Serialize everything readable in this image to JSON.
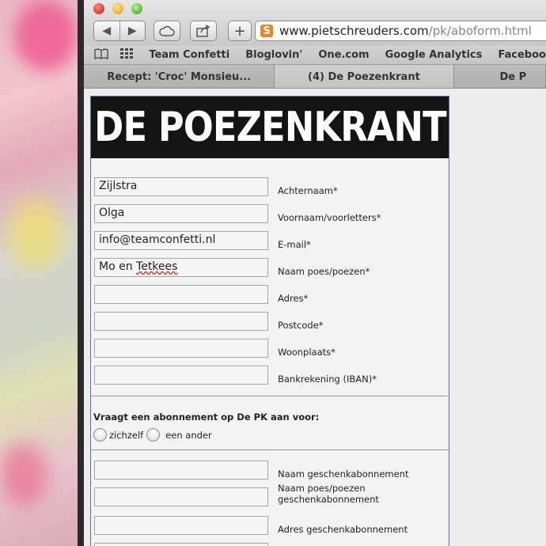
{
  "browser": {
    "url_host": "www.pietschreuders.com",
    "url_path": "/pk/aboform.html",
    "favicon_letter": "S",
    "buttons": {
      "back": "◀",
      "forward": "▶",
      "add": "+"
    },
    "bookmarks": [
      "Team Confetti",
      "Bloglovin'",
      "One.com",
      "Google Analytics",
      "Faceboo"
    ],
    "tabs": [
      "Recept: 'Croc' Monsieu...",
      "(4) De Poezenkrant",
      "De P"
    ]
  },
  "page": {
    "masthead": "DE POEZENKRANT",
    "fields": [
      {
        "value": "Zijlstra",
        "label": "Achternaam*"
      },
      {
        "value": "Olga",
        "label": "Voornaam/voorletters*"
      },
      {
        "value": "info@teamconfetti.nl",
        "label": "E-mail*"
      },
      {
        "value_pre": "Mo en ",
        "value_spell": "Tetkees",
        "label": "Naam poes/poezen*"
      },
      {
        "value": "",
        "label": "Adres*"
      },
      {
        "value": "",
        "label": "Postcode*"
      },
      {
        "value": "",
        "label": "Woonplaats*"
      },
      {
        "value": "",
        "label": "Bankrekening (IBAN)*"
      }
    ],
    "question": "Vraagt een abonnement op De PK aan voor:",
    "radio_options": [
      "zichzelf",
      "een ander"
    ],
    "gift_fields": [
      {
        "value": "",
        "label": "Naam geschenkabonnement"
      },
      {
        "value": "",
        "label": "Naam poes/poezen geschenkabonnement"
      },
      {
        "value": "",
        "label": "Adres geschenkabonnement"
      }
    ]
  }
}
